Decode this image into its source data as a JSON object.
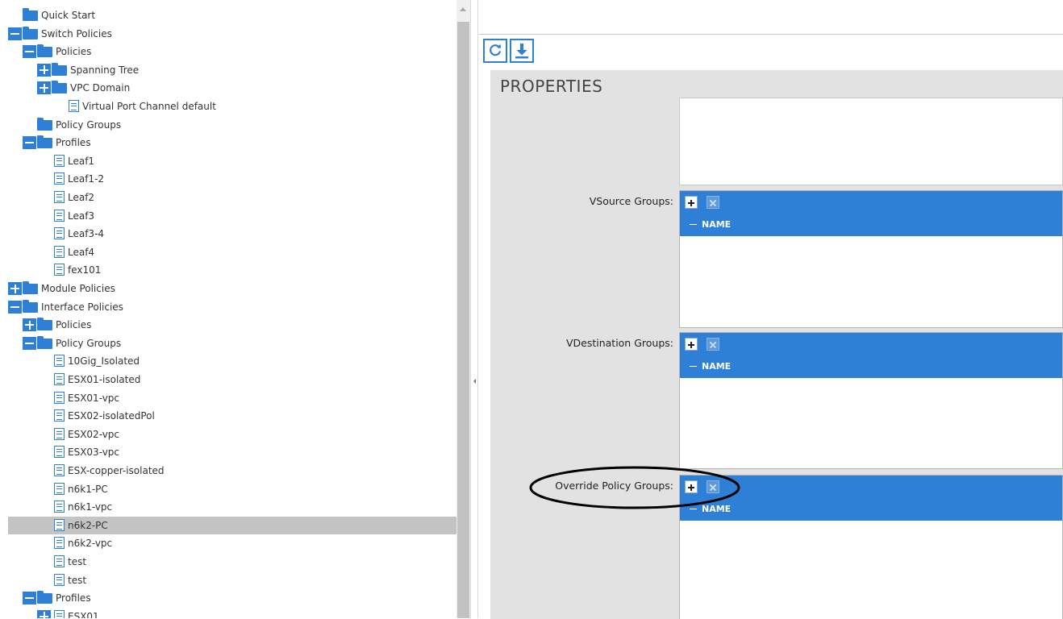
{
  "tree": {
    "items": [
      {
        "label": "Quick Start",
        "type": "folder",
        "level": 0,
        "toggle": "none"
      },
      {
        "label": "Switch Policies",
        "type": "folder",
        "level": 0,
        "toggle": "minus"
      },
      {
        "label": "Policies",
        "type": "folder",
        "level": 1,
        "toggle": "minus"
      },
      {
        "label": "Spanning Tree",
        "type": "folder",
        "level": 2,
        "toggle": "plus"
      },
      {
        "label": "VPC Domain",
        "type": "folder",
        "level": 2,
        "toggle": "plus"
      },
      {
        "label": "Virtual Port Channel default",
        "type": "doc",
        "level": 3,
        "toggle": "none"
      },
      {
        "label": "Policy Groups",
        "type": "folder",
        "level": 1,
        "toggle": "none"
      },
      {
        "label": "Profiles",
        "type": "folder",
        "level": 1,
        "toggle": "minus"
      },
      {
        "label": "Leaf1",
        "type": "doc",
        "level": 2,
        "toggle": "none"
      },
      {
        "label": "Leaf1-2",
        "type": "doc",
        "level": 2,
        "toggle": "none"
      },
      {
        "label": "Leaf2",
        "type": "doc",
        "level": 2,
        "toggle": "none"
      },
      {
        "label": "Leaf3",
        "type": "doc",
        "level": 2,
        "toggle": "none"
      },
      {
        "label": "Leaf3-4",
        "type": "doc",
        "level": 2,
        "toggle": "none"
      },
      {
        "label": "Leaf4",
        "type": "doc",
        "level": 2,
        "toggle": "none"
      },
      {
        "label": "fex101",
        "type": "doc",
        "level": 2,
        "toggle": "none"
      },
      {
        "label": "Module Policies",
        "type": "folder",
        "level": 0,
        "toggle": "plus"
      },
      {
        "label": "Interface Policies",
        "type": "folder",
        "level": 0,
        "toggle": "minus"
      },
      {
        "label": "Policies",
        "type": "folder",
        "level": 1,
        "toggle": "plus"
      },
      {
        "label": "Policy Groups",
        "type": "folder",
        "level": 1,
        "toggle": "minus"
      },
      {
        "label": "10Gig_Isolated",
        "type": "doc",
        "level": 2,
        "toggle": "none"
      },
      {
        "label": "ESX01-isolated",
        "type": "doc",
        "level": 2,
        "toggle": "none"
      },
      {
        "label": "ESX01-vpc",
        "type": "doc",
        "level": 2,
        "toggle": "none"
      },
      {
        "label": "ESX02-isolatedPol",
        "type": "doc",
        "level": 2,
        "toggle": "none"
      },
      {
        "label": "ESX02-vpc",
        "type": "doc",
        "level": 2,
        "toggle": "none"
      },
      {
        "label": "ESX03-vpc",
        "type": "doc",
        "level": 2,
        "toggle": "none"
      },
      {
        "label": "ESX-copper-isolated",
        "type": "doc",
        "level": 2,
        "toggle": "none"
      },
      {
        "label": "n6k1-PC",
        "type": "doc",
        "level": 2,
        "toggle": "none"
      },
      {
        "label": "n6k1-vpc",
        "type": "doc",
        "level": 2,
        "toggle": "none"
      },
      {
        "label": "n6k2-PC",
        "type": "doc",
        "level": 2,
        "toggle": "none",
        "selected": true
      },
      {
        "label": "n6k2-vpc",
        "type": "doc",
        "level": 2,
        "toggle": "none"
      },
      {
        "label": "test",
        "type": "doc",
        "level": 2,
        "toggle": "none"
      },
      {
        "label": "test",
        "type": "doc",
        "level": 2,
        "toggle": "none"
      },
      {
        "label": "Profiles",
        "type": "folder",
        "level": 1,
        "toggle": "minus"
      },
      {
        "label": "ESX01",
        "type": "doc",
        "level": 2,
        "toggle": "plus"
      }
    ]
  },
  "toolbar": {
    "refresh_icon": "refresh-icon",
    "download_icon": "download-icon"
  },
  "properties": {
    "title": "PROPERTIES",
    "groups": [
      {
        "label": "VSource Groups:",
        "column": "NAME"
      },
      {
        "label": "VDestination Groups:",
        "column": "NAME"
      },
      {
        "label": "Override Policy Groups:",
        "column": "NAME",
        "annotated": true
      }
    ]
  },
  "colors": {
    "accent": "#2e7fd6",
    "selected_row": "#c4c4c4",
    "panel_bg": "#e2e2e2"
  }
}
